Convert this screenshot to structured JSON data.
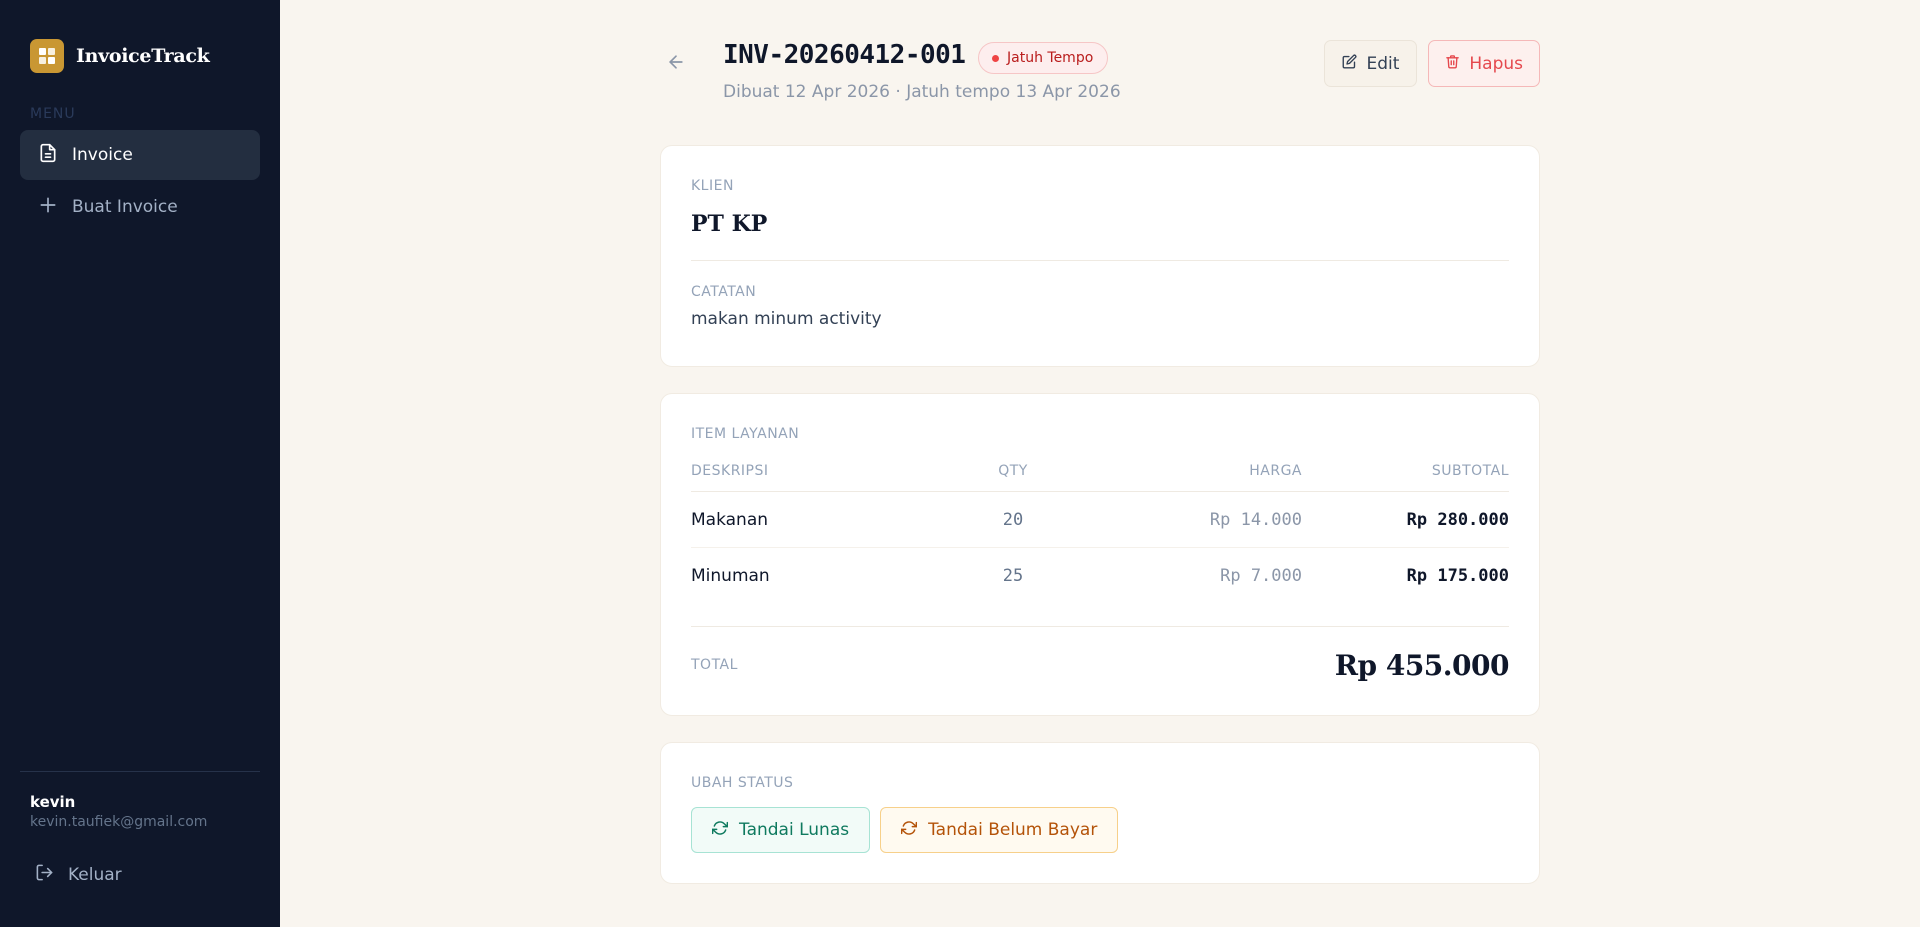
{
  "brand": {
    "name": "InvoiceTrack"
  },
  "sidebar": {
    "menu_label": "MENU",
    "items": [
      {
        "label": "Invoice",
        "icon": "file-text-icon",
        "active": true
      },
      {
        "label": "Buat Invoice",
        "icon": "plus-icon",
        "active": false
      }
    ],
    "user": {
      "name": "kevin",
      "email": "kevin.taufiek@gmail.com"
    },
    "logout_label": "Keluar"
  },
  "invoice": {
    "number": "INV-20260412-001",
    "status": "Jatuh Tempo",
    "status_color": "#ef4444",
    "meta": "Dibuat 12 Apr 2026 · Jatuh tempo 13 Apr 2026",
    "edit_label": "Edit",
    "delete_label": "Hapus"
  },
  "client": {
    "label": "KLIEN",
    "name": "PT KP",
    "notes_label": "CATATAN",
    "notes": "makan minum activity"
  },
  "items": {
    "label": "ITEM LAYANAN",
    "columns": {
      "desc": "DESKRIPSI",
      "qty": "QTY",
      "price": "HARGA",
      "subtotal": "SUBTOTAL"
    },
    "rows": [
      {
        "desc": "Makanan",
        "qty": "20",
        "price": "Rp 14.000",
        "subtotal": "Rp 280.000"
      },
      {
        "desc": "Minuman",
        "qty": "25",
        "price": "Rp 7.000",
        "subtotal": "Rp 175.000"
      }
    ],
    "total_label": "TOTAL",
    "total": "Rp 455.000"
  },
  "status_change": {
    "label": "UBAH STATUS",
    "paid_label": "Tandai Lunas",
    "unpaid_label": "Tandai Belum Bayar",
    "paid_color": "#0f7a5f",
    "unpaid_color": "#b45309"
  },
  "colors": {
    "sidebar_bg": "#0f172a",
    "accent": "#c99733",
    "page_bg": "#f9f5ef",
    "danger": "#e5484d"
  }
}
